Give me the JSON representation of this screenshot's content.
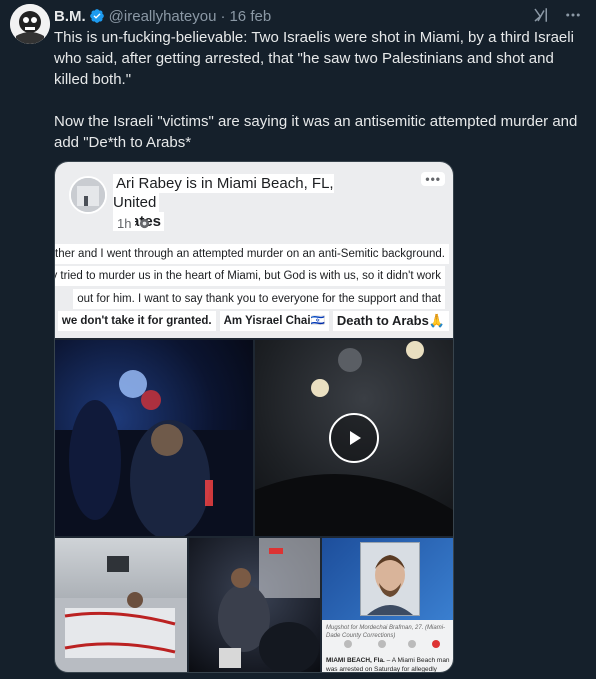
{
  "tweet": {
    "author_name": "B.M.",
    "handle": "@ireallyhateyou",
    "date": "16 feb",
    "text_p1": "This is un-fucking-believable: Two Israelis were shot in Miami, by a third Israeli who said, after getting arrested, that \"he saw two Palestinians and shot and killed both.\"",
    "text_p2": "Now the Israeli \"victims\" are saying it was an antisemitic attempted murder and add \"De*th to Arabs*"
  },
  "icons": {
    "verified": "verified-badge-icon",
    "grok": "grok-icon",
    "more": "more-horizontal-icon",
    "play": "play-icon"
  },
  "colors": {
    "accent": "#1d9bf0",
    "bg": "#15202b",
    "text": "#e7e9ea",
    "muted": "#8b98a5"
  },
  "fb_post": {
    "title_line1": "Ari Rabey is in Miami Beach, FL, United",
    "title_line2": "States",
    "time": "1h",
    "more": "•••",
    "line1": "My father and I went through an attempted murder on an anti-Semitic background.",
    "line2": "They tried to murder us in the heart of Miami, but God is with us, so it didn't work",
    "line3": "out for him. I want to say thank you to everyone for the support and that",
    "line4a": "we don't take it for granted.",
    "line4b": "Am Yisrael Chai🇮🇱",
    "line4c": "Death to Arabs🙏"
  },
  "news": {
    "caption": "Mugshot for Mordechai Brafman, 27. (Miami-Dade County Corrections)",
    "text_bold": "MIAMI BEACH, Fla.",
    "text_rest": " – A Miami Beach man was arrested on Saturday for allegedly opening fire on"
  }
}
